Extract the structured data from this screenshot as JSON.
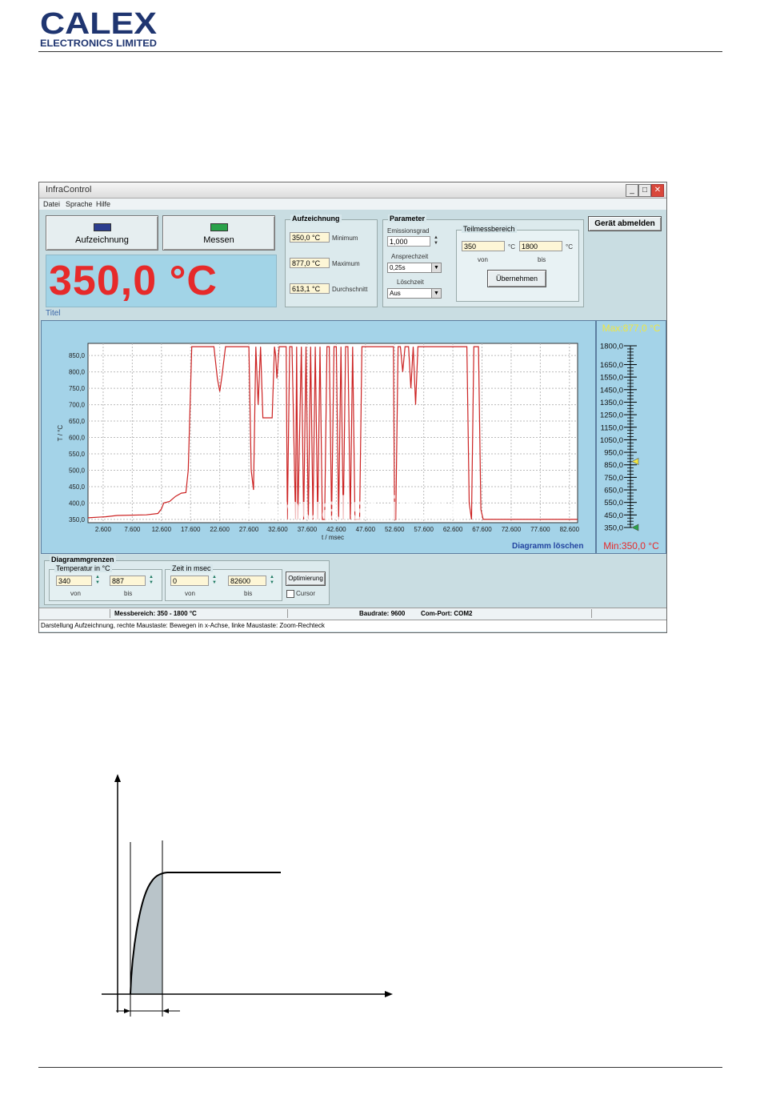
{
  "logo": {
    "brand": "CALEX",
    "subtitle": "ELECTRONICS LIMITED"
  },
  "window": {
    "title": "InfraControl",
    "controls": [
      "_",
      "□",
      "✕"
    ],
    "menu": [
      "Datei",
      "Sprache",
      "Hilfe"
    ]
  },
  "buttons": {
    "record": "Aufzeichnung",
    "measure": "Messen",
    "logout": "Gerät abmelden",
    "apply": "Übernehmen",
    "optimize": "Optimierung"
  },
  "colors": {
    "record_led": "#2b3d8f",
    "measure_led": "#2aa24a",
    "temp_display": "#e62a2a",
    "trace": "#cc2222"
  },
  "display": {
    "temperature": "350,0 °C",
    "title_label": "Titel"
  },
  "recording": {
    "title": "Aufzeichnung",
    "minimum_value": "350,0 °C",
    "minimum_label": "Minimum",
    "maximum_value": "877,0 °C",
    "maximum_label": "Maximum",
    "average_value": "613,1 °C",
    "average_label": "Durchschnitt"
  },
  "parameters": {
    "title": "Parameter",
    "emissivity_label": "Emissionsgrad",
    "emissivity_value": "1,000",
    "response_label": "Ansprechzeit",
    "response_value": "0,25s",
    "clear_label": "Löschzeit",
    "clear_value": "Aus",
    "subrange_title": "Teilmessbereich",
    "from_value": "350",
    "to_value": "1800",
    "unit": "°C",
    "from_label": "von",
    "to_label": "bis"
  },
  "scale": {
    "max_label": "Max:877,0 °C",
    "min_label": "Min:350,0 °C",
    "ticks": [
      "1800,0",
      "1650,0",
      "1550,0",
      "1450,0",
      "1350,0",
      "1250,0",
      "1150,0",
      "1050,0",
      "950,0",
      "850,0",
      "750,0",
      "650,0",
      "550,0",
      "450,0",
      "350,0"
    ],
    "max_value": 877.0,
    "min_value": 350.0
  },
  "chart": {
    "clear_label": "Diagramm löschen",
    "watermark": "ManualsLib.de"
  },
  "limits": {
    "title": "Diagrammgrenzen",
    "temp_title": "Temperatur in °C",
    "temp_from": "340",
    "temp_to": "887",
    "time_title": "Zeit in msec",
    "time_from": "0",
    "time_to": "82600",
    "from_label": "von",
    "to_label": "bis",
    "cursor_label": "Cursor"
  },
  "status": {
    "range": "Messbereich: 350 - 1800 °C",
    "baud": "Baudrate: 9600",
    "port": "Com-Port: COM2",
    "hint": "Darstellung Aufzeichnung, rechte Maustaste: Bewegen in x-Achse, linke Maustaste: Zoom-Rechteck"
  },
  "chart_data": {
    "type": "line",
    "title": "",
    "xlabel": "t / msec",
    "ylabel": "T / °C",
    "xlim": [
      0,
      84000
    ],
    "ylim": [
      340,
      887
    ],
    "x_ticks": [
      2600,
      7600,
      12600,
      17600,
      22600,
      27600,
      32600,
      37600,
      42600,
      47600,
      52600,
      57600,
      62600,
      67600,
      72600,
      77600,
      82600
    ],
    "x_tick_labels": [
      "2.600",
      "7.600",
      "12.600",
      "17.600",
      "22.600",
      "27.600",
      "32.600",
      "37.600",
      "42.600",
      "47.600",
      "52.600",
      "57.600",
      "62.600",
      "67.600",
      "72.600",
      "77.600",
      "82.600"
    ],
    "y_ticks": [
      350,
      400,
      450,
      500,
      550,
      600,
      650,
      700,
      750,
      800,
      850
    ],
    "y_tick_labels": [
      "350,0",
      "400,0",
      "450,0",
      "500,0",
      "550,0",
      "600,0",
      "650,0",
      "700,0",
      "750,0",
      "800,0",
      "850,0"
    ],
    "grid": true,
    "series": [
      {
        "x": [
          0,
          3000,
          5000,
          10000,
          12000,
          12600,
          13000,
          14000,
          15000,
          16000,
          16800,
          17200,
          17800,
          18000,
          19000,
          20000,
          21000,
          21600,
          22200,
          22600,
          23000,
          23600,
          24000,
          25000,
          26000,
          27000,
          27600,
          28000,
          28400,
          28800,
          29200,
          29600,
          30000,
          30400,
          30800,
          31600,
          32000,
          32200,
          32400,
          32800,
          33200,
          33600,
          34000,
          34200,
          34600,
          35000,
          35600,
          35800,
          36000,
          36600,
          37000,
          37400,
          37800,
          38200,
          38600,
          39000,
          39400,
          39800,
          40200,
          40600,
          41000,
          41400,
          41800,
          42200,
          42600,
          43000,
          43400,
          43800,
          44200,
          44600,
          45000,
          45400,
          45800,
          46200,
          46600,
          47000,
          48000,
          50000,
          52000,
          52400,
          52600,
          52800,
          53200,
          53600,
          54000,
          54400,
          55000,
          55400,
          55800,
          56200,
          56600,
          57000,
          57400,
          57800,
          58200,
          58600,
          59000,
          59400,
          59800,
          60200,
          60600,
          61000,
          62000,
          63000,
          64000,
          64600,
          65000,
          65400,
          65800,
          66200,
          66600,
          67000,
          67400,
          67800,
          68200,
          70000,
          74000,
          78000,
          82000,
          84000
        ],
        "y": [
          355,
          358,
          362,
          364,
          368,
          382,
          400,
          405,
          420,
          430,
          432,
          500,
          877,
          877,
          877,
          877,
          877,
          877,
          780,
          740,
          790,
          877,
          877,
          877,
          877,
          877,
          877,
          500,
          440,
          877,
          700,
          877,
          660,
          660,
          660,
          660,
          877,
          850,
          780,
          877,
          877,
          877,
          877,
          350,
          877,
          877,
          350,
          877,
          350,
          877,
          350,
          877,
          350,
          877,
          350,
          877,
          350,
          877,
          350,
          350,
          877,
          877,
          350,
          877,
          877,
          350,
          877,
          350,
          877,
          877,
          350,
          877,
          350,
          350,
          350,
          877,
          877,
          877,
          877,
          877,
          350,
          350,
          877,
          877,
          800,
          877,
          877,
          750,
          877,
          700,
          877,
          877,
          877,
          877,
          877,
          877,
          877,
          877,
          877,
          877,
          877,
          877,
          877,
          877,
          877,
          877,
          877,
          400,
          350,
          877,
          877,
          877,
          380,
          350,
          350,
          350,
          350,
          350,
          350,
          350
        ]
      }
    ]
  }
}
